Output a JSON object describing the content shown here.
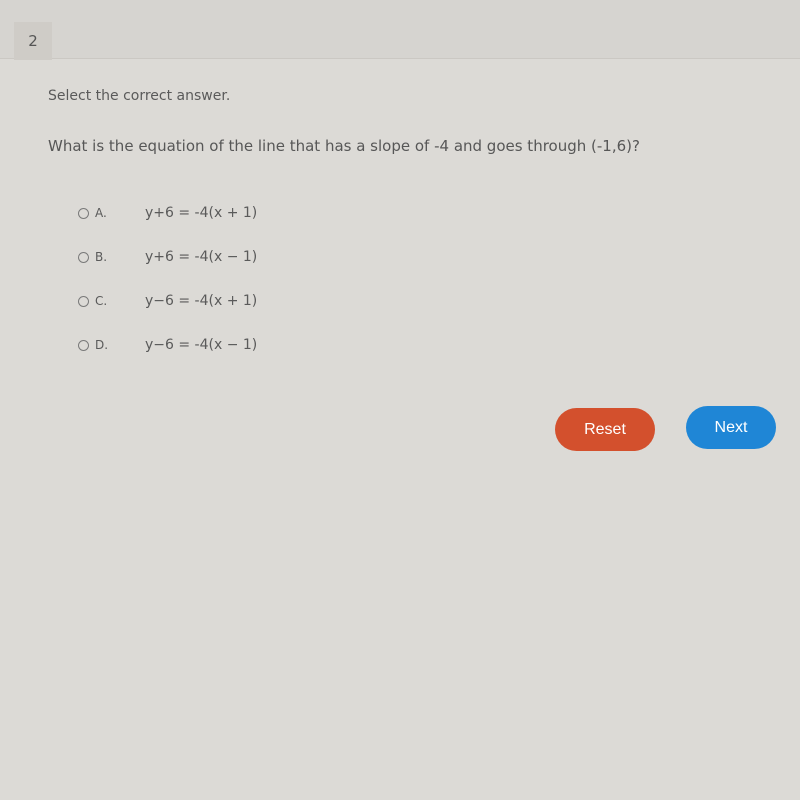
{
  "header": {
    "question_number": "2"
  },
  "question": {
    "instruction": "Select the correct answer.",
    "prompt": "What is the equation of the line that has a slope of -4 and goes through (-1,6)?"
  },
  "options": [
    {
      "letter": "A.",
      "equation": "y+6 = -4(x + 1)"
    },
    {
      "letter": "B.",
      "equation": "y+6 = -4(x − 1)"
    },
    {
      "letter": "C.",
      "equation": "y−6 = -4(x + 1)"
    },
    {
      "letter": "D.",
      "equation": "y−6 = -4(x − 1)"
    }
  ],
  "buttons": {
    "reset": "Reset",
    "next": "Next"
  },
  "colors": {
    "reset": "#d3502d",
    "next": "#1f86d6"
  }
}
